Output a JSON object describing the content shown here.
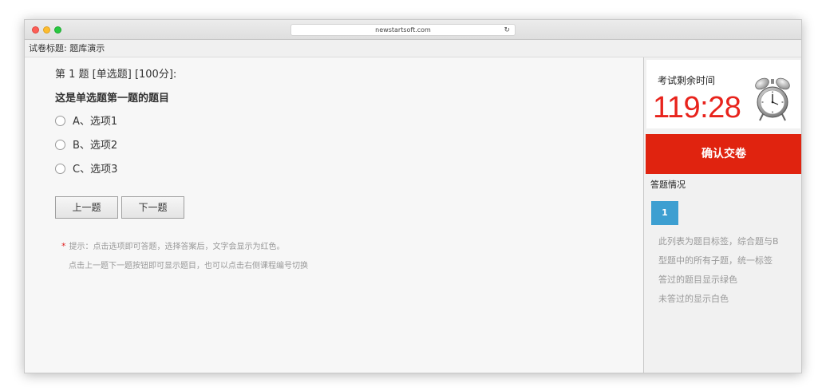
{
  "browser": {
    "url": "newstartsoft.com"
  },
  "header": {
    "label": "试卷标题:",
    "value": "题库演示"
  },
  "question": {
    "title": "第 1 题 [单选题] [100分]:",
    "text": "这是单选题第一题的题目",
    "options": [
      {
        "label": "A、选项1"
      },
      {
        "label": "B、选项2"
      },
      {
        "label": "C、选项3"
      }
    ]
  },
  "nav": {
    "prev_label": "上一题",
    "next_label": "下一题"
  },
  "hints": {
    "line1": "提示：点击选项即可答题，选择答案后，文字会显示为红色。",
    "line2": "点击上一题下一题按钮即可显示题目，也可以点击右侧课程编号切换"
  },
  "sidebar": {
    "timer_label": "考试剩余时间",
    "timer_value": "119:28",
    "submit_label": "确认交卷",
    "status_label": "答题情况",
    "question_numbers": [
      "1"
    ],
    "legend": [
      "此列表为题目标签，综合题与B",
      "型题中的所有子题，统一标签",
      "答过的题目显示绿色",
      "未答过的显示白色"
    ]
  },
  "icons": {
    "alarm_clock": "alarm-clock-icon",
    "reload": "reload-icon"
  },
  "colors": {
    "accent_red": "#e0230f",
    "timer_red": "#e8231c",
    "question_number_blue": "#3d9fd1"
  }
}
